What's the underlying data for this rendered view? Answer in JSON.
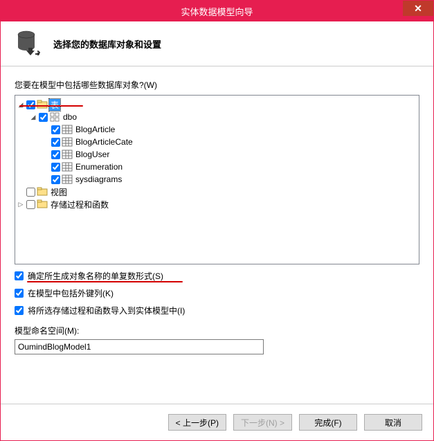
{
  "window": {
    "title": "实体数据模型向导",
    "close_glyph": "✕"
  },
  "header": {
    "subtitle": "选择您的数据库对象和设置"
  },
  "prompt": "您要在模型中包括哪些数据库对象?(W)",
  "tree": {
    "tables_label": "表",
    "dbo_label": "dbo",
    "items": [
      {
        "label": "BlogArticle"
      },
      {
        "label": "BlogArticleCate"
      },
      {
        "label": "BlogUser"
      },
      {
        "label": "Enumeration"
      },
      {
        "label": "sysdiagrams"
      }
    ],
    "views_label": "视图",
    "procs_label": "存储过程和函数"
  },
  "options": {
    "pluralize": "确定所生成对象名称的单复数形式(S)",
    "include_fk": "在模型中包括外键列(K)",
    "import_procs": "将所选存储过程和函数导入到实体模型中(I)"
  },
  "namespace": {
    "label": "模型命名空间(M):",
    "value": "OumindBlogModel1"
  },
  "buttons": {
    "prev": "< 上一步(P)",
    "next": "下一步(N) >",
    "finish": "完成(F)",
    "cancel": "取消"
  }
}
